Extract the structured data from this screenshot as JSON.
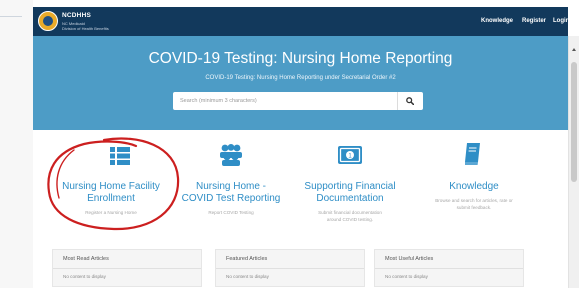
{
  "header": {
    "org_name": "NCDHHS",
    "org_line1": "NC Medicaid",
    "org_line2": "Division of Health Benefits",
    "nav": [
      "Knowledge",
      "Register",
      "Login"
    ]
  },
  "hero": {
    "title": "COVID-19 Testing: Nursing Home Reporting",
    "subtitle": "COVID-19 Testing: Nursing Home Reporting under Secretarial Order #2",
    "search_placeholder": "Search (minimum 3 characters)"
  },
  "features": [
    {
      "icon": "list-icon",
      "title_line1": "Nursing Home Facility",
      "title_line2": "Enrollment",
      "desc_line1": "Register a Nursing Home",
      "desc_line2": ""
    },
    {
      "icon": "group-icon",
      "title_line1": "Nursing Home -",
      "title_line2": "COVID Test Reporting",
      "desc_line1": "Report COVID Testing",
      "desc_line2": ""
    },
    {
      "icon": "money-icon",
      "title_line1": "Supporting Financial",
      "title_line2": "Documentation",
      "desc_line1": "Submit financial documentation",
      "desc_line2": "around COVID testing."
    },
    {
      "icon": "book-icon",
      "title_line1": "Knowledge",
      "title_line2": "",
      "desc_line1": "Browse and search for articles, rate or",
      "desc_line2": "submit feedback."
    }
  ],
  "panels": [
    {
      "title": "Most Read Articles",
      "empty": "No content to display"
    },
    {
      "title": "Featured Articles",
      "empty": "No content to display"
    },
    {
      "title": "Most Useful Articles",
      "empty": "No content to display"
    }
  ],
  "colors": {
    "navbar": "#12395c",
    "hero": "#4d9cc6",
    "feature_title": "#2f8ec6",
    "annotation": "#cc1f1f"
  }
}
